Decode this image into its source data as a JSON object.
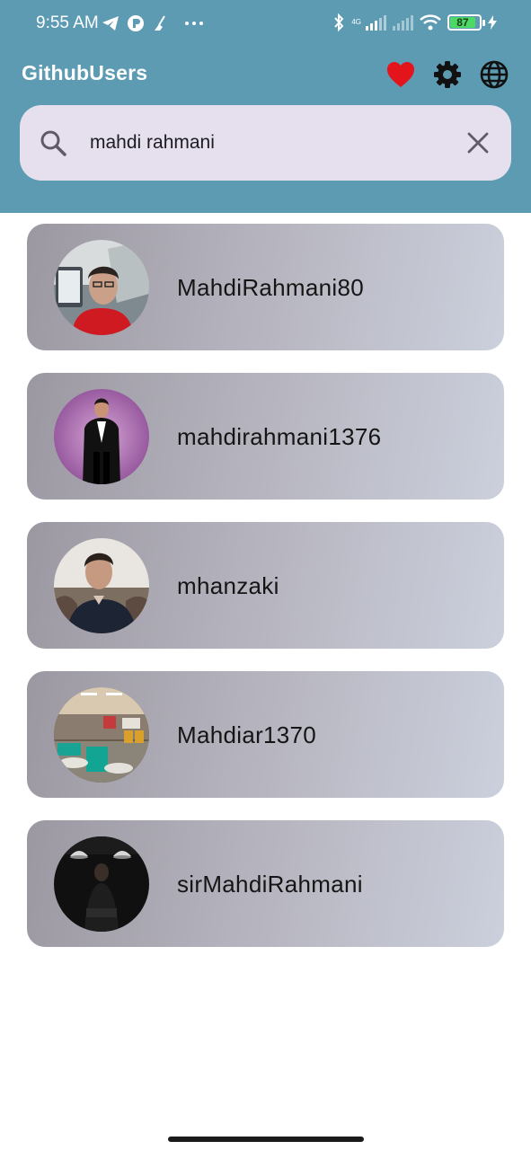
{
  "status_bar": {
    "time": "9:55 AM",
    "network_label": "4G",
    "battery": "87"
  },
  "app_bar": {
    "title": "GithubUsers",
    "actions": [
      {
        "icon": "heart-icon",
        "color": "#e02020"
      },
      {
        "icon": "gear-icon",
        "color": "#111111"
      },
      {
        "icon": "globe-icon",
        "color": "#111111"
      }
    ]
  },
  "search": {
    "value": "mahdi rahmani",
    "icon": "search-icon",
    "clear_icon": "close-icon"
  },
  "users": [
    {
      "username": "MahdiRahmani80"
    },
    {
      "username": "mahdirahmani1376"
    },
    {
      "username": "mhanzaki"
    },
    {
      "username": "Mahdiar1370"
    },
    {
      "username": "sirMahdiRahmani"
    }
  ],
  "colors": {
    "header_bg": "#5c9bb2",
    "search_bg": "#e6e0ee",
    "card_gradient_start": "#9b98a2",
    "card_gradient_end": "#cbd0dc"
  }
}
